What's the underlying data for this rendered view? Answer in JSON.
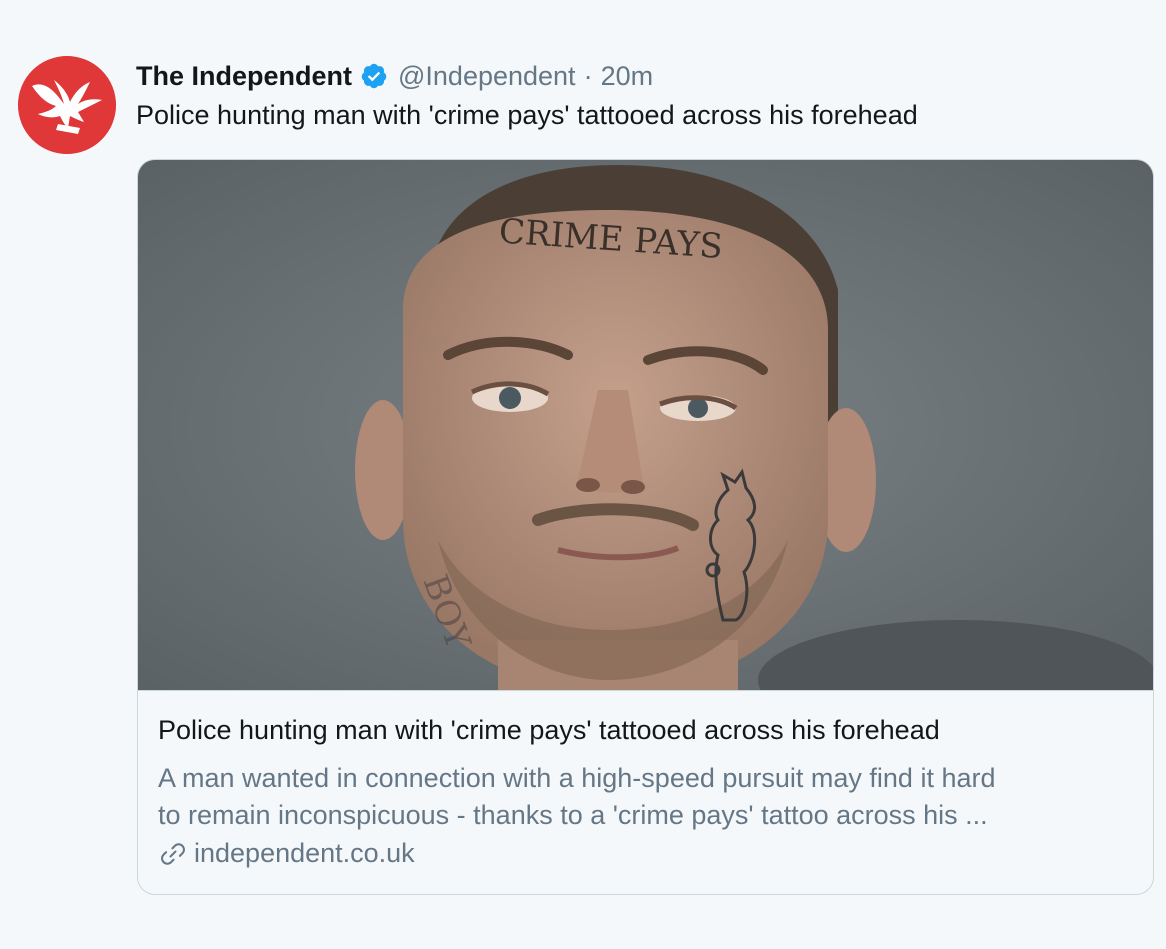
{
  "tweet": {
    "display_name": "The Independent",
    "handle": "@Independent",
    "separator": "·",
    "time": "20m",
    "text": "Police hunting man with 'crime pays' tattooed across his forehead",
    "verified_icon": "verified-badge-icon",
    "avatar_icon": "eagle-logo-icon"
  },
  "card": {
    "image_caption_tattoo": "CRIME PAYS",
    "title": "Police hunting man with 'crime pays' tattooed across his forehead",
    "description_line1": "A man wanted in connection with a high-speed pursuit may find it hard",
    "description_line2": "to remain inconspicuous - thanks to a 'crime pays' tattoo across his ...",
    "domain": "independent.co.uk",
    "link_icon": "link-icon"
  },
  "colors": {
    "brand_red": "#e03838",
    "verified_blue": "#1da1f2",
    "text_primary": "#14171a",
    "text_secondary": "#657786",
    "border": "#ccd6dd",
    "background": "#f5f8fa"
  }
}
